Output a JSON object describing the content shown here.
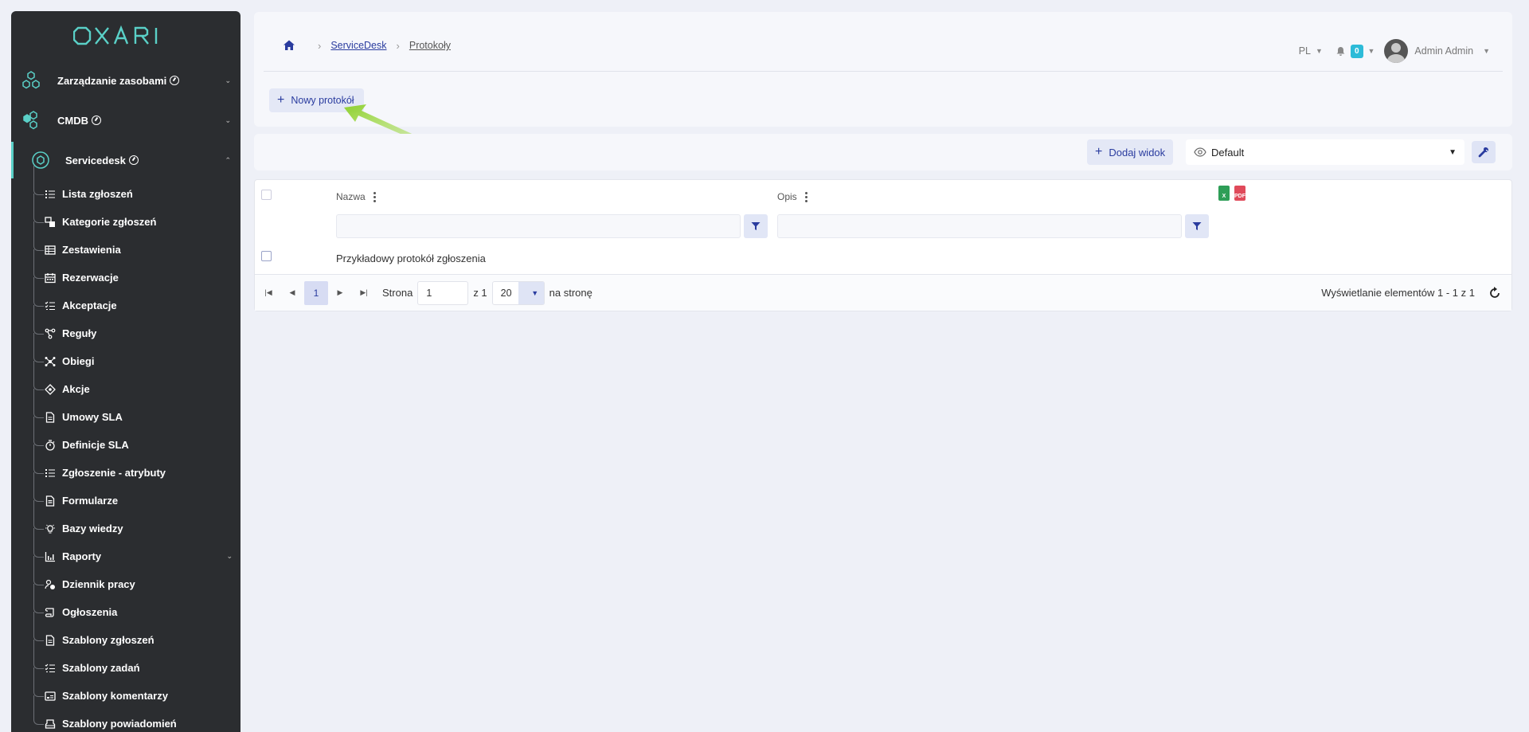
{
  "brand": {
    "logo_text": "OXARI",
    "accent": "#5ad0c7"
  },
  "sidebar": {
    "top_items": [
      {
        "label": "Zarządzanie zasobami",
        "icon": "hexagons-icon"
      },
      {
        "label": "CMDB",
        "icon": "cmdb-icon"
      },
      {
        "label": "Servicedesk",
        "icon": "servicedesk-icon"
      }
    ],
    "sub_items": [
      {
        "label": "Lista zgłoszeń",
        "icon": "list-icon"
      },
      {
        "label": "Kategorie zgłoszeń",
        "icon": "categories-icon"
      },
      {
        "label": "Zestawienia",
        "icon": "table-icon"
      },
      {
        "label": "Rezerwacje",
        "icon": "calendar-icon"
      },
      {
        "label": "Akceptacje",
        "icon": "checklist-icon"
      },
      {
        "label": "Reguły",
        "icon": "rules-icon"
      },
      {
        "label": "Obiegi",
        "icon": "workflow-icon"
      },
      {
        "label": "Akcje",
        "icon": "actions-icon"
      },
      {
        "label": "Umowy SLA",
        "icon": "document-icon"
      },
      {
        "label": "Definicje SLA",
        "icon": "stopwatch-icon"
      },
      {
        "label": "Zgłoszenie - atrybuty",
        "icon": "list-icon"
      },
      {
        "label": "Formularze",
        "icon": "form-icon"
      },
      {
        "label": "Bazy wiedzy",
        "icon": "lightbulb-icon"
      },
      {
        "label": "Raporty",
        "icon": "chart-icon"
      },
      {
        "label": "Dziennik pracy",
        "icon": "user-clock-icon"
      },
      {
        "label": "Ogłoszenia",
        "icon": "scroll-icon"
      },
      {
        "label": "Szablony zgłoszeń",
        "icon": "document-icon"
      },
      {
        "label": "Szablony zadań",
        "icon": "checklist-icon"
      },
      {
        "label": "Szablony komentarzy",
        "icon": "comment-template-icon"
      },
      {
        "label": "Szablony powiadomień",
        "icon": "notification-template-icon"
      }
    ]
  },
  "header": {
    "breadcrumb": {
      "home_icon": "home-icon",
      "item1": "ServiceDesk",
      "item2": "Protokoły"
    },
    "lang": "PL",
    "notifications_count": "0",
    "user_name": "Admin Admin",
    "new_button": "Nowy protokół"
  },
  "toolbar": {
    "add_view": "Dodaj widok",
    "view_selected": "Default"
  },
  "table": {
    "columns": [
      {
        "label": "Nazwa"
      },
      {
        "label": "Opis"
      }
    ],
    "rows": [
      {
        "name": "Przykładowy protokół zgłoszenia",
        "description": ""
      }
    ],
    "export": {
      "xls": "X",
      "pdf": "PDF"
    }
  },
  "pager": {
    "current_page": "1",
    "page_label": "Strona",
    "page_input": "1",
    "of_label": "z 1",
    "page_size": "20",
    "per_page_label": "na stronę",
    "info": "Wyświetlanie elementów 1 - 1 z 1"
  }
}
